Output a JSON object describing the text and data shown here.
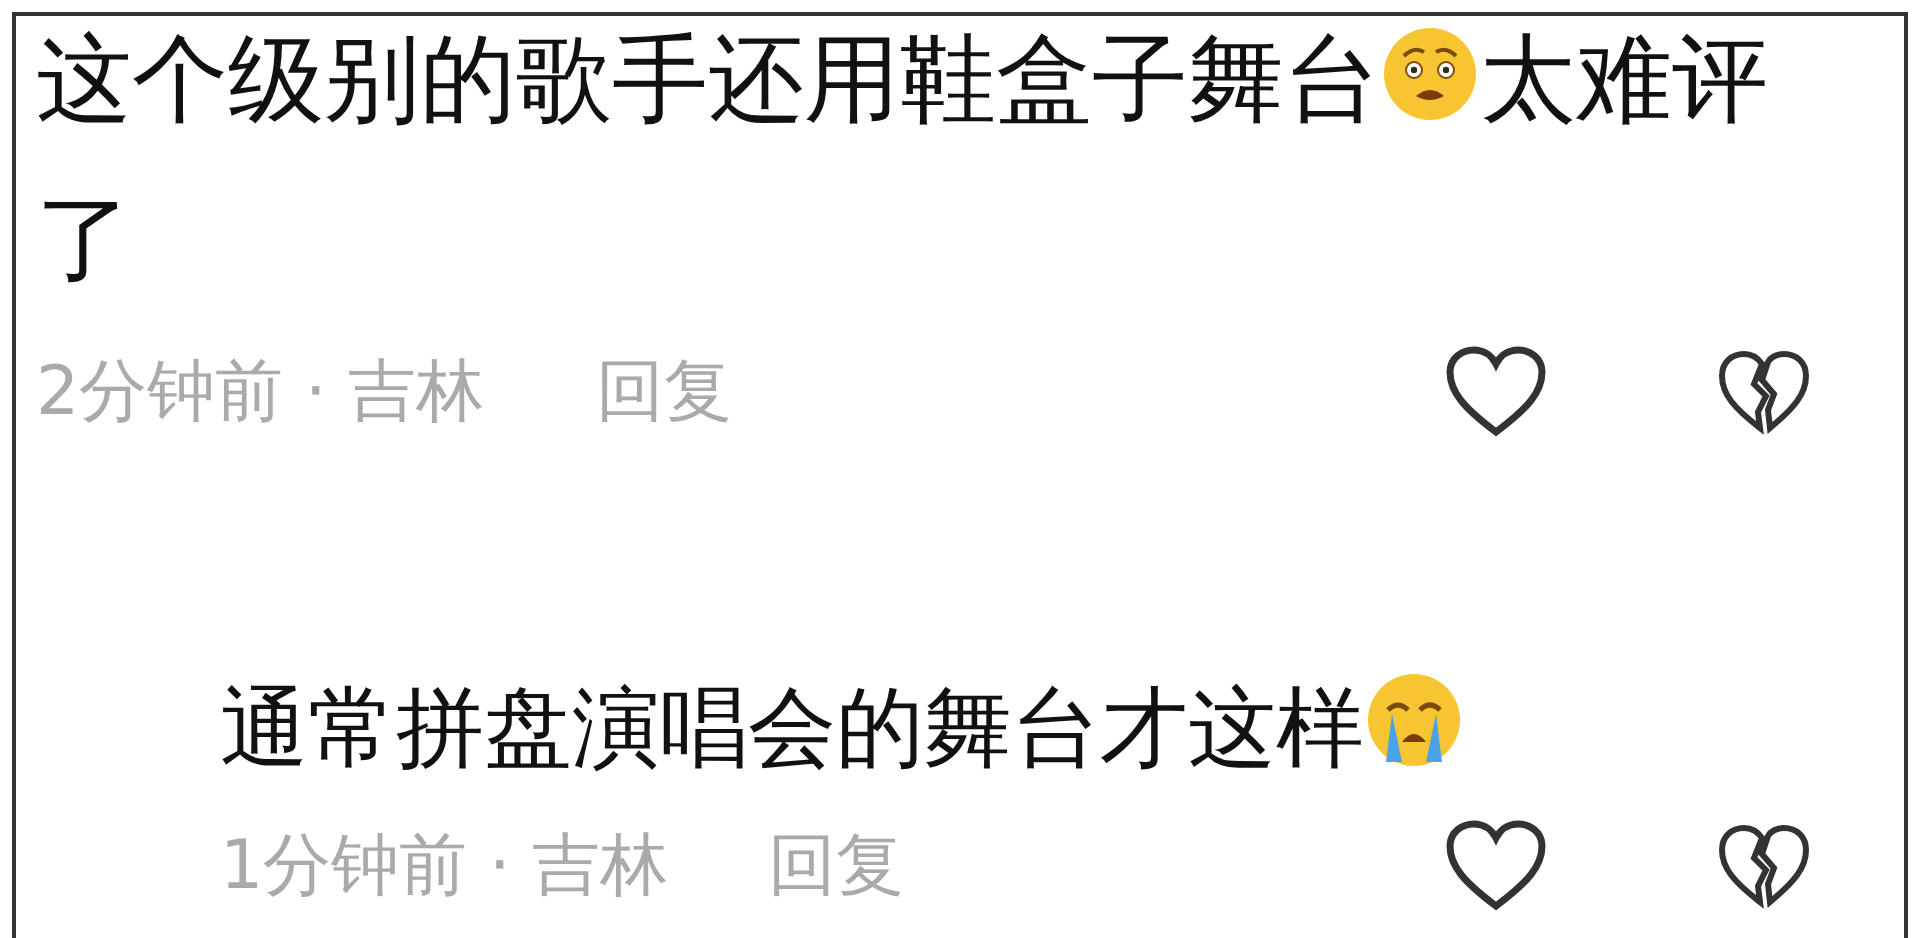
{
  "comments": [
    {
      "segments": [
        {
          "kind": "text",
          "text": "这个级别的歌手还用鞋盒子舞台"
        },
        {
          "kind": "worried"
        },
        {
          "kind": "text",
          "text": "太难评"
        },
        {
          "kind": "text",
          "text": "了"
        }
      ],
      "time": "2分钟前 · 吉林",
      "reply": "回复",
      "children": [
        {
          "segments": [
            {
              "kind": "text",
              "text": "通常拼盘演唱会的舞台才这样"
            },
            {
              "kind": "crying"
            }
          ],
          "time": "1分钟前 · 吉林",
          "reply": "回复"
        }
      ]
    }
  ]
}
